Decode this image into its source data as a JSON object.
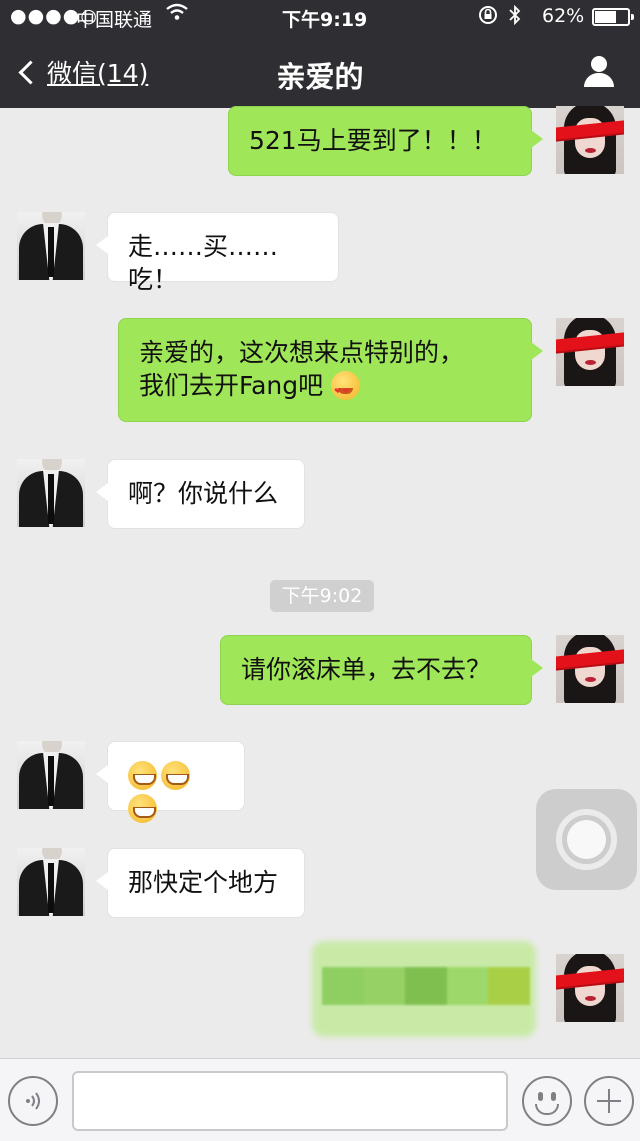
{
  "status_bar": {
    "signal": "●●●●○",
    "carrier": "中国联通",
    "time": "下午9:19",
    "battery": "62%"
  },
  "nav": {
    "back_label": "微信(14)",
    "title": "亲爱的"
  },
  "messages": [
    {
      "from": "me",
      "text": "521马上要到了！！！"
    },
    {
      "from": "other",
      "text": "走……买……吃！"
    },
    {
      "from": "me",
      "lines": [
        "亲爱的，这次想来点特别的，",
        "我们去开Fang吧"
      ],
      "emoji": "heart-eyes-emoji"
    },
    {
      "from": "other",
      "text": "啊？你说什么"
    },
    {
      "from": "me",
      "text": "请你滚床单，去不去？"
    },
    {
      "from": "other",
      "emoji_count": 3,
      "emoji": "grin-emoji"
    },
    {
      "from": "other",
      "text": "那快定个地方"
    },
    {
      "from": "me",
      "blurred": true
    }
  ],
  "timestamp": "下午9:02",
  "colors": {
    "header_bg": "#2f2f33",
    "chat_bg": "#ebebeb",
    "out_bubble": "#9fe658",
    "in_bubble": "#ffffff"
  }
}
